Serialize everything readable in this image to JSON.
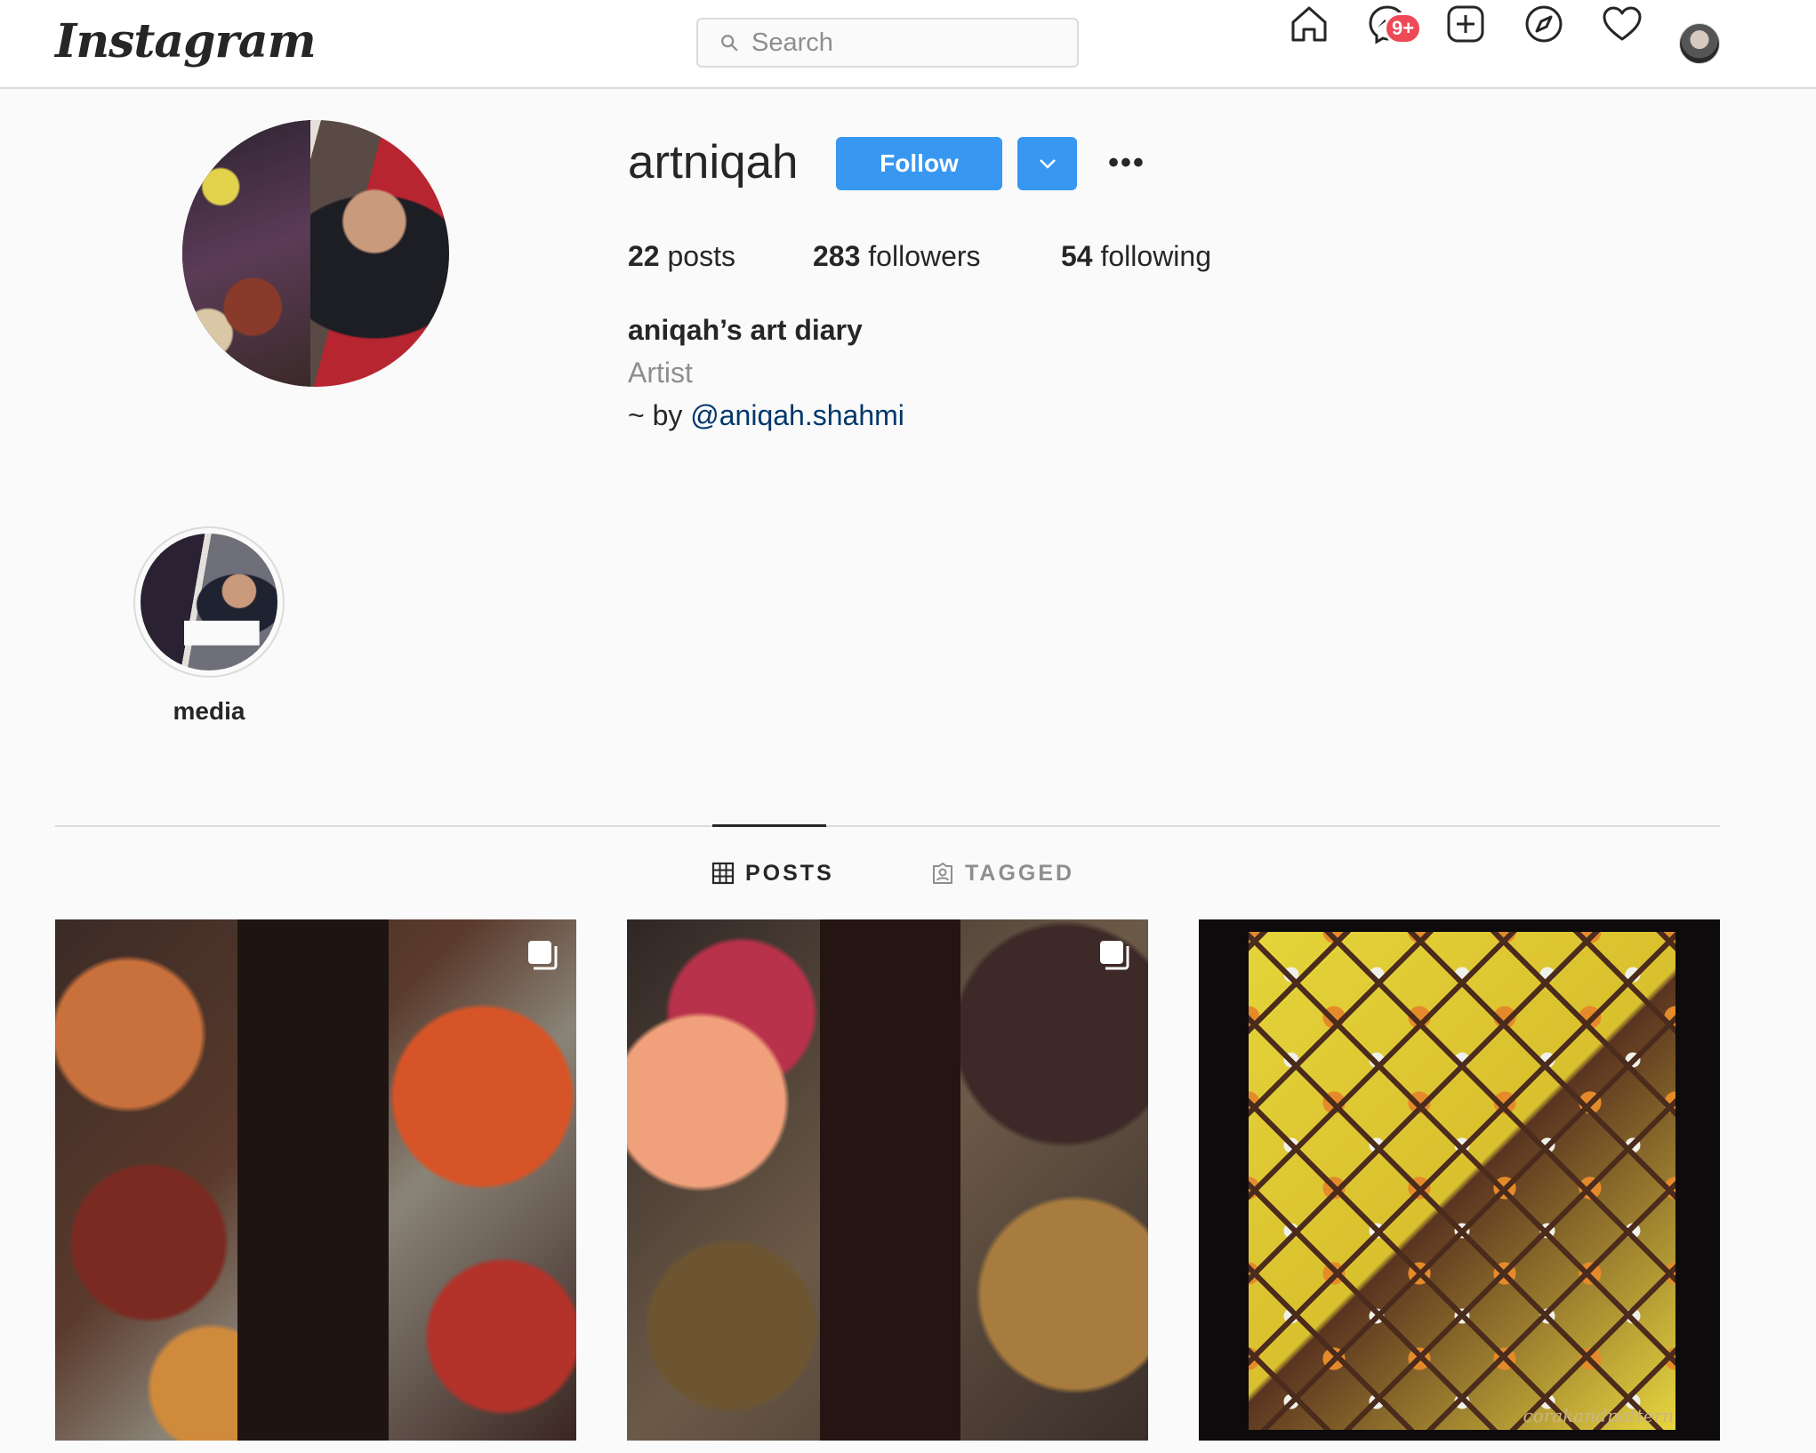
{
  "nav": {
    "logo": "Instagram",
    "search_placeholder": "Search",
    "messages_badge": "9+",
    "icons": [
      "home-icon",
      "messenger-icon",
      "new-post-icon",
      "explore-icon",
      "activity-heart-icon",
      "profile-avatar"
    ]
  },
  "profile": {
    "username": "artniqah",
    "follow_label": "Follow",
    "more_label": "•••",
    "stats": {
      "posts_count": "22",
      "posts_label": "posts",
      "followers_count": "283",
      "followers_label": "followers",
      "following_count": "54",
      "following_label": "following"
    },
    "bio": {
      "name": "aniqah’s art diary",
      "category": "Artist",
      "line_prefix": "~ by ",
      "mention": "@aniqah.shahmi"
    }
  },
  "highlights": [
    {
      "label": "media"
    }
  ],
  "tabs": {
    "posts": "POSTS",
    "tagged": "TAGGED",
    "active": "posts"
  },
  "posts": [
    {
      "kind": "carousel",
      "subject": "batik skateboard deck orange"
    },
    {
      "kind": "carousel",
      "subject": "batik skateboard deck floral"
    },
    {
      "kind": "single",
      "subject": "batik diamond pattern painting",
      "signature": "corakandpattern"
    }
  ],
  "colors": {
    "accent": "#3897f0",
    "badge": "#ed4956",
    "link": "#00376b",
    "muted": "#8e8e8e"
  }
}
